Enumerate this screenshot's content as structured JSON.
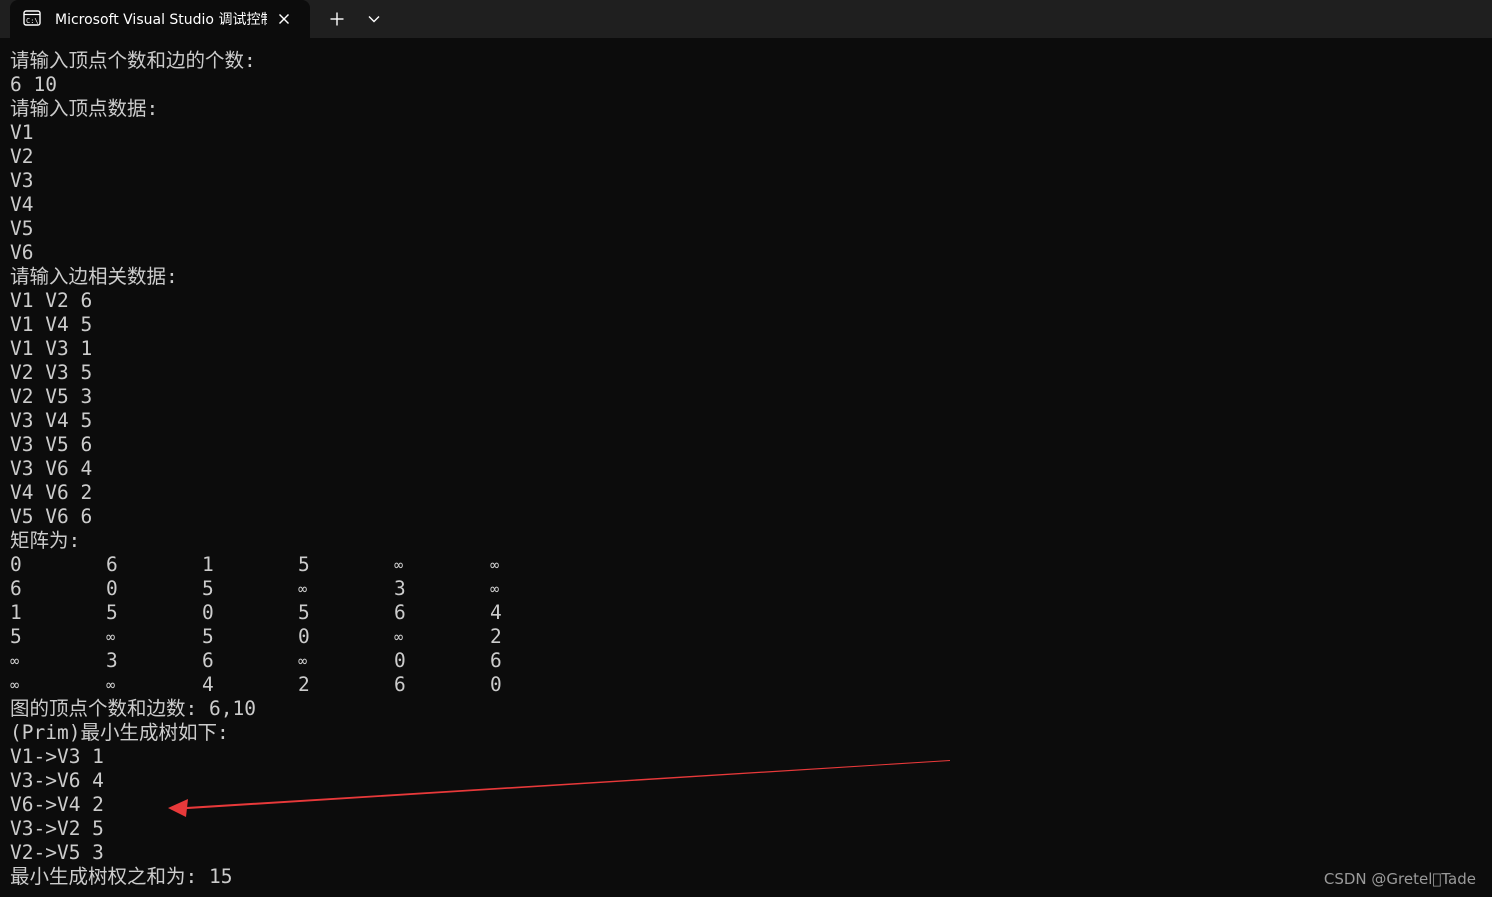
{
  "tab": {
    "title": "Microsoft Visual Studio 调试控制台",
    "icon": "console-icon",
    "close_icon": "close-icon",
    "new_tab_icon": "plus-icon",
    "dropdown_icon": "chevron-down-icon"
  },
  "console": {
    "lines_before_matrix": [
      "请输入顶点个数和边的个数:",
      "6 10",
      "请输入顶点数据:",
      "V1",
      "V2",
      "V3",
      "V4",
      "V5",
      "V6",
      "请输入边相关数据:",
      "V1 V2 6",
      "V1 V4 5",
      "V1 V3 1",
      "V2 V3 5",
      "V2 V5 3",
      "V3 V4 5",
      "V3 V5 6",
      "V3 V6 4",
      "V4 V6 2",
      "V5 V6 6",
      "矩阵为:"
    ],
    "matrix": [
      [
        "0",
        "6",
        "1",
        "5",
        "∞",
        "∞"
      ],
      [
        "6",
        "0",
        "5",
        "∞",
        "3",
        "∞"
      ],
      [
        "1",
        "5",
        "0",
        "5",
        "6",
        "4"
      ],
      [
        "5",
        "∞",
        "5",
        "0",
        "∞",
        "2"
      ],
      [
        "∞",
        "3",
        "6",
        "∞",
        "0",
        "6"
      ],
      [
        "∞",
        "∞",
        "4",
        "2",
        "6",
        "0"
      ]
    ],
    "lines_after_matrix": [
      "图的顶点个数和边数: 6,10",
      "(Prim)最小生成树如下:",
      "V1->V3 1",
      "V3->V6 4",
      "V6->V4 2",
      "V3->V2 5",
      "V2->V5 3",
      "最小生成树权之和为: 15"
    ]
  },
  "annotation": {
    "arrow_color": "#e8393a",
    "arrow_icon": "red-arrow-annotation"
  },
  "watermark": "CSDN @Gretel\u0000Tade",
  "colors": {
    "background": "#0c0c0c",
    "titlebar": "#1f1f1f",
    "text": "#cccccc"
  }
}
